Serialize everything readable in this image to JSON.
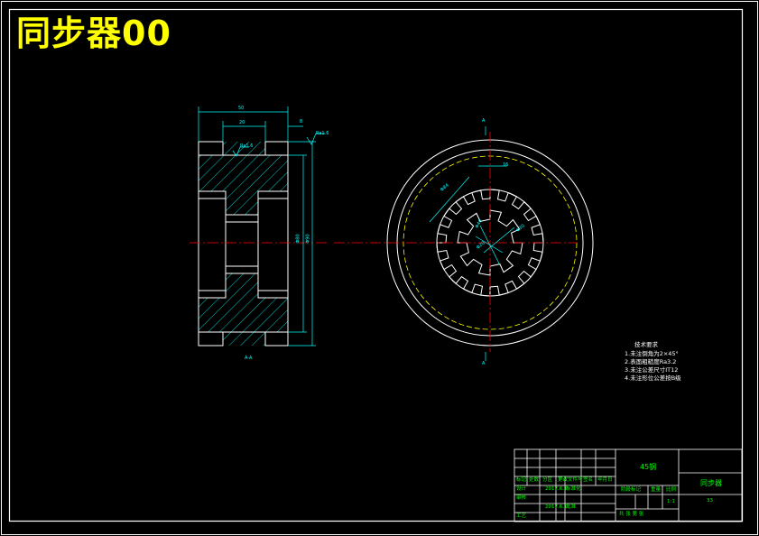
{
  "drawing": {
    "title": "同步器00",
    "colors": {
      "background": "#000000",
      "outline": "#ffffff",
      "dimension": "#00ffff",
      "centerline": "#ff0000",
      "dashed_circle": "#ffff00",
      "title_text": "#ffff00",
      "titleblock_text": "#00ff00"
    }
  },
  "section_view": {
    "label": "A-A",
    "dims": {
      "overall_width": "50",
      "inner_width": "20",
      "chamfer": "8",
      "roughness_top": "Ra1.6",
      "roughness_groove": "Ra1.6",
      "outer_dia": "Φ90",
      "inner_dia": "Φ80"
    }
  },
  "front_view": {
    "section_mark_top": "A",
    "section_mark_bottom": "A",
    "dims": {
      "spline_width": "16",
      "pitch_dia": "Φ84",
      "tooth_dim": "Φ40",
      "bore_dim": "Φ30",
      "hub_dim": "Φ20"
    }
  },
  "tech_notes": {
    "heading": "技术要求",
    "items": [
      "1.未注倒角为2×45°",
      "2.表面粗糙度Ra3.2",
      "3.未注公差尺寸IT12",
      "4.未注形位公差按B级"
    ]
  },
  "title_block": {
    "part_name": "同步器",
    "material": "45钢",
    "row_labels": [
      "标记",
      "处数",
      "分区",
      "更改文件号",
      "签名",
      "年月日"
    ],
    "design_label": "设计",
    "design_date": "2017.6.1",
    "design_std": "标准化",
    "review_label": "审核",
    "process_label": "工艺",
    "process_date": "2017.6.1",
    "approve_label": "批准",
    "stage_label": "阶段标记",
    "weight_label": "重量",
    "scale_label": "比例",
    "scale_value": "1:1",
    "sheet_text": "共 张 第 张",
    "drawing_number": "33"
  }
}
